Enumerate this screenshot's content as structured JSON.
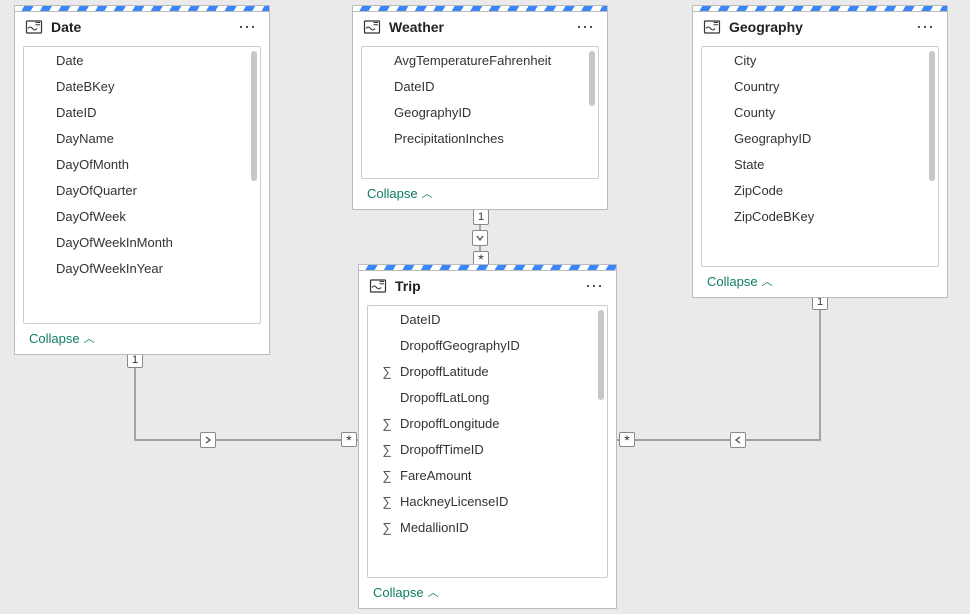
{
  "tables": {
    "date": {
      "title": "Date",
      "collapse": "Collapse",
      "fields": [
        {
          "label": "Date"
        },
        {
          "label": "DateBKey"
        },
        {
          "label": "DateID"
        },
        {
          "label": "DayName"
        },
        {
          "label": "DayOfMonth"
        },
        {
          "label": "DayOfQuarter"
        },
        {
          "label": "DayOfWeek"
        },
        {
          "label": "DayOfWeekInMonth"
        },
        {
          "label": "DayOfWeekInYear"
        }
      ]
    },
    "weather": {
      "title": "Weather",
      "collapse": "Collapse",
      "fields": [
        {
          "label": "AvgTemperatureFahrenheit"
        },
        {
          "label": "DateID"
        },
        {
          "label": "GeographyID"
        },
        {
          "label": "PrecipitationInches"
        }
      ]
    },
    "geography": {
      "title": "Geography",
      "collapse": "Collapse",
      "fields": [
        {
          "label": "City"
        },
        {
          "label": "Country"
        },
        {
          "label": "County"
        },
        {
          "label": "GeographyID"
        },
        {
          "label": "State"
        },
        {
          "label": "ZipCode"
        },
        {
          "label": "ZipCodeBKey"
        }
      ]
    },
    "trip": {
      "title": "Trip",
      "collapse": "Collapse",
      "fields": [
        {
          "label": "DateID"
        },
        {
          "label": "DropoffGeographyID"
        },
        {
          "label": "DropoffLatitude",
          "sigma": true
        },
        {
          "label": "DropoffLatLong"
        },
        {
          "label": "DropoffLongitude",
          "sigma": true
        },
        {
          "label": "DropoffTimeID",
          "sigma": true
        },
        {
          "label": "FareAmount",
          "sigma": true
        },
        {
          "label": "HackneyLicenseID",
          "sigma": true
        },
        {
          "label": "MedallionID",
          "sigma": true
        }
      ]
    }
  },
  "relationships": {
    "weather_trip": {
      "from": "1",
      "to": "*"
    },
    "date_trip": {
      "from": "1",
      "to": "*"
    },
    "geography_trip": {
      "from": "1",
      "to": "*"
    }
  }
}
